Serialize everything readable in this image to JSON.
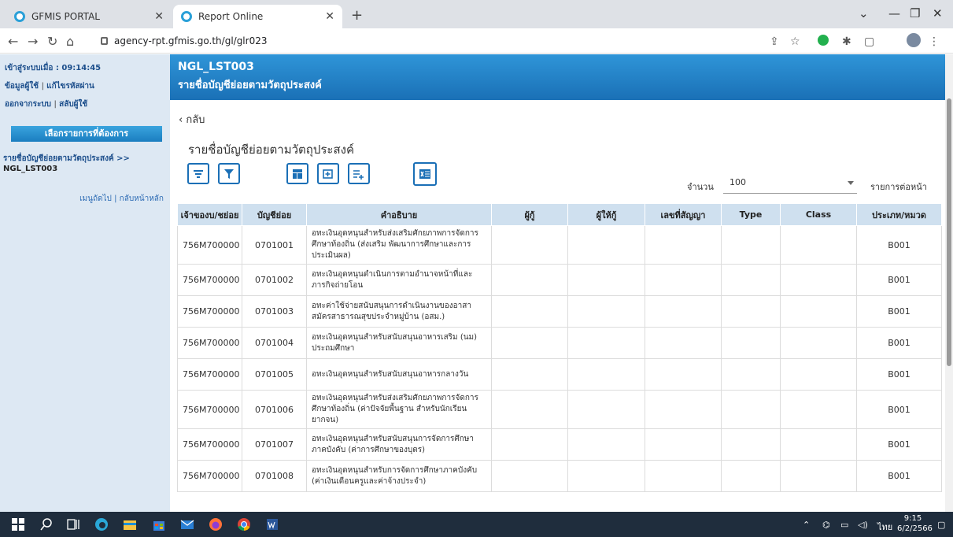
{
  "browser": {
    "tabs": [
      {
        "label": "GFMIS PORTAL"
      },
      {
        "label": "Report Online"
      }
    ],
    "url": "agency-rpt.gfmis.go.th/gl/glr023"
  },
  "sidebar": {
    "login_label": "เข้าสู่ระบบเมื่อ : 09:14:45",
    "user_info": "ข้อมูลผู้ใช้",
    "change_password": "แก้ไขรหัสผ่าน",
    "logout": "ออกจากระบบ",
    "switch_user": "สลับผู้ใช้",
    "select_header": "เลือกรายการที่ต้องการ",
    "breadcrumb_link": "รายชื่อบัญชีย่อยตามวัตถุประสงค์ >>",
    "breadcrumb_code": "NGL_LST003",
    "next_menu": "เมนูถัดไป",
    "main_page": "กลับหน้าหลัก"
  },
  "header": {
    "code": "NGL_LST003",
    "subtitle": "รายชื่อบัญชีย่อยตามวัตถุประสงค์"
  },
  "back_label": "กลับ",
  "main_title": "รายชื่อบัญชีย่อยตามวัตถุประสงค์",
  "pagination": {
    "count_label": "จำนวน",
    "count_value": "100",
    "suffix": "รายการต่อหน้า"
  },
  "table": {
    "headers": [
      "เจ้าของบ/ชย่อย",
      "บัญชีย่อย",
      "คำอธิบาย",
      "ผู้กู้",
      "ผู้ให้กู้",
      "เลขที่สัญญา",
      "Type",
      "Class",
      "ประเภท/หมวด"
    ],
    "rows": [
      [
        "756M700000",
        "0701001",
        "อทะเงินอุดหนุนสำหรับส่งเสริมศักยภาพการจัดการศึกษาท้องถิ่น (ส่งเสริม พัฒนาการศึกษาและการประเมินผล)",
        "",
        "",
        "",
        "",
        "",
        "B001"
      ],
      [
        "756M700000",
        "0701002",
        "อทะเงินอุดหนุนดำเนินการตามอำนาจหน้าที่และภารกิจถ่ายโอน",
        "",
        "",
        "",
        "",
        "",
        "B001"
      ],
      [
        "756M700000",
        "0701003",
        "อทะค่าใช้จ่ายสนับสนุนการดำเนินงานของอาสาสมัครสาธารณสุขประจำหมู่บ้าน (อสม.)",
        "",
        "",
        "",
        "",
        "",
        "B001"
      ],
      [
        "756M700000",
        "0701004",
        "อทะเงินอุดหนุนสำหรับสนับสนุนอาหารเสริม (นม) ประถมศึกษา",
        "",
        "",
        "",
        "",
        "",
        "B001"
      ],
      [
        "756M700000",
        "0701005",
        "อทะเงินอุดหนุนสำหรับสนับสนุนอาหารกลางวัน",
        "",
        "",
        "",
        "",
        "",
        "B001"
      ],
      [
        "756M700000",
        "0701006",
        "อทะเงินอุดหนุนสำหรับส่งเสริมศักยภาพการจัดการศึกษาท้องถิ่น (ค่าปัจจัยพื้นฐาน สำหรับนักเรียนยากจน)",
        "",
        "",
        "",
        "",
        "",
        "B001"
      ],
      [
        "756M700000",
        "0701007",
        "อทะเงินอุดหนุนสำหรับสนับสนุนการจัดการศึกษาภาคบังคับ (ค่าการศึกษาของบุตร)",
        "",
        "",
        "",
        "",
        "",
        "B001"
      ],
      [
        "756M700000",
        "0701008",
        "อทะเงินอุดหนุนสำหรับการจัดการศึกษาภาคบังคับ (ค่าเงินเดือนครูและค่าจ้างประจำ)",
        "",
        "",
        "",
        "",
        "",
        "B001"
      ]
    ]
  },
  "taskbar": {
    "lang": "ไทย",
    "time": "9:15",
    "date": "6/2/2566"
  }
}
